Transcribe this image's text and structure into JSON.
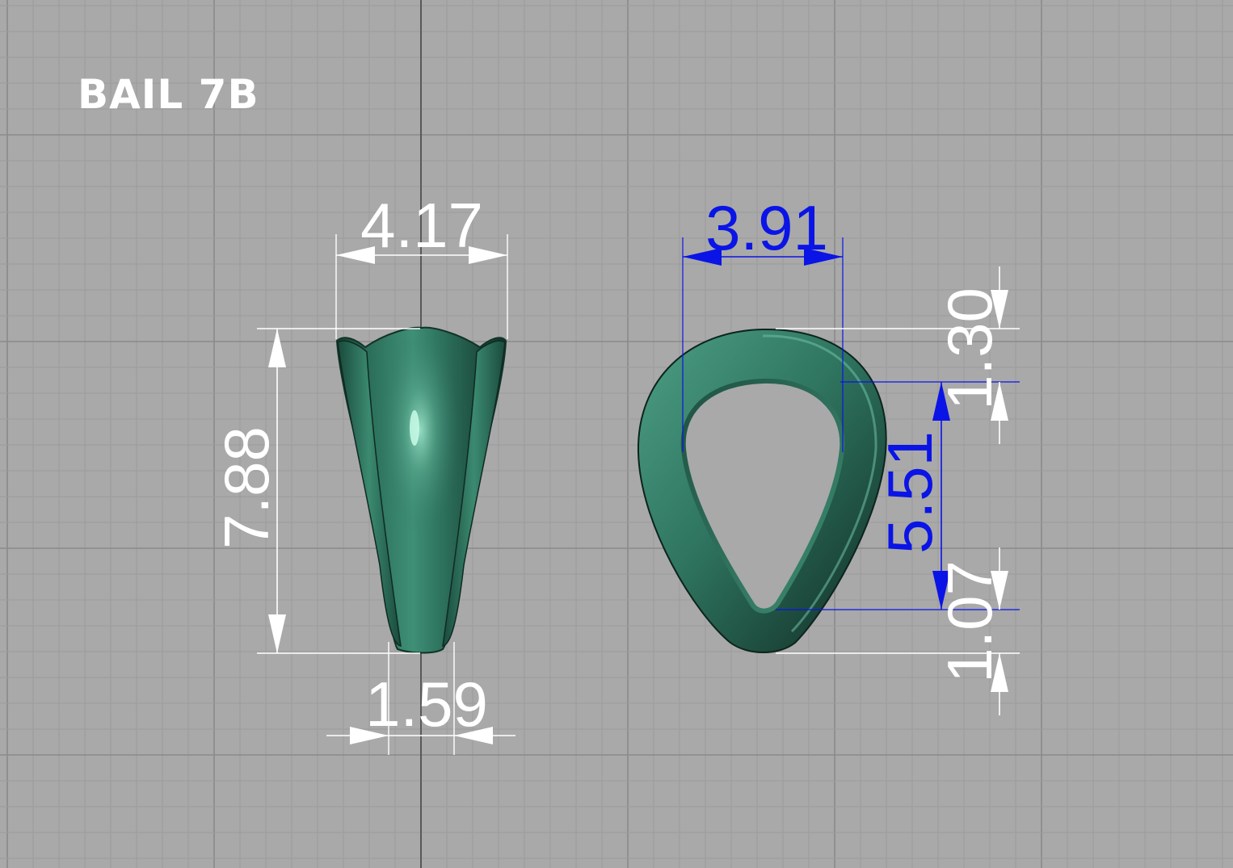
{
  "title": "BAIL 7B",
  "colors": {
    "background": "#a9a9a9",
    "grid_minor": "#9c9c9c",
    "grid_major": "#8a8a8a",
    "axis": "#4a4a4a",
    "part": "#2f7560",
    "part_dark": "#153b30",
    "part_light": "#6fbfa5",
    "dim_white": "#ffffff",
    "dim_blue": "#0a14e6"
  },
  "dimensions": {
    "front_width": "4.17",
    "front_height": "7.88",
    "front_bottom_width": "1.59",
    "side_width": "3.91",
    "side_top_thickness": "1.30",
    "side_inner_height": "5.51",
    "side_bottom_thickness": "1.07"
  }
}
